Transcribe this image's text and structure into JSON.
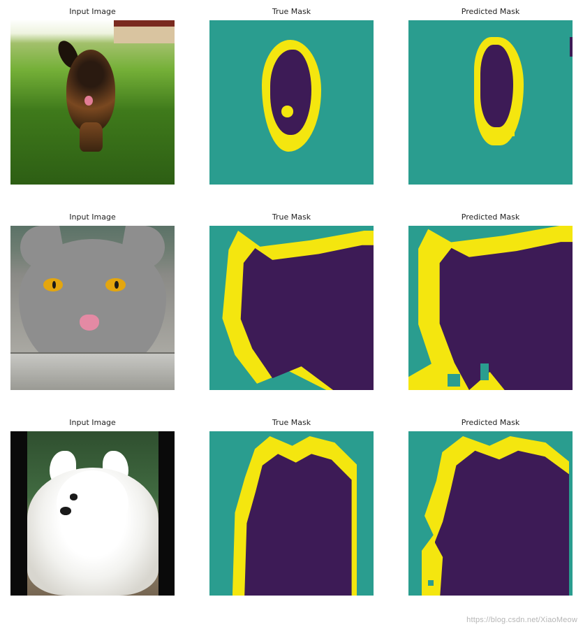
{
  "columns": {
    "input": "Input Image",
    "true": "True Mask",
    "pred": "Predicted Mask"
  },
  "rows": [
    {
      "subject": "running-brown-dog"
    },
    {
      "subject": "gray-cat-tongue"
    },
    {
      "subject": "white-fluffy-dog"
    }
  ],
  "mask_colors": {
    "background": "#2a9d8f",
    "boundary": "#f4e60f",
    "foreground": "#3d1b56"
  },
  "watermark": "https://blog.csdn.net/XiaoMeow"
}
